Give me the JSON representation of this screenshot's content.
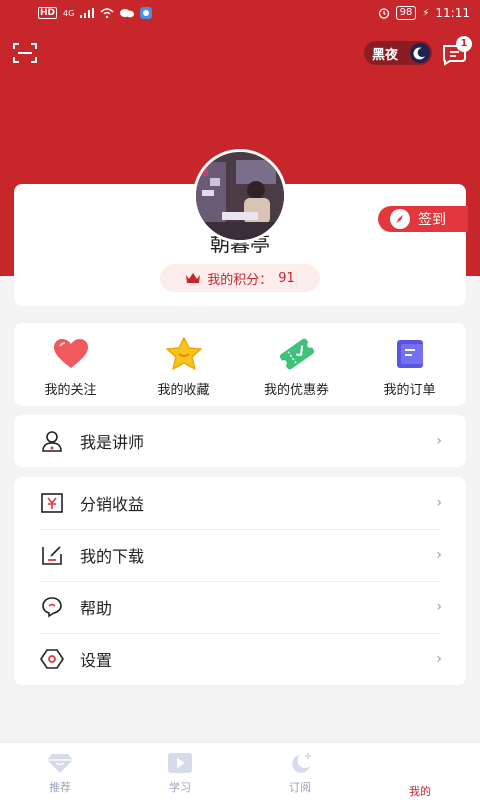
{
  "status_bar": {
    "network": "HD",
    "signal": "4G",
    "battery": "98",
    "time": "11:11"
  },
  "header": {
    "night_label": "黑夜",
    "message_count": "1"
  },
  "profile": {
    "name": "朝暮亭",
    "points_label": "我的积分：",
    "points_value": "91",
    "checkin_label": "签到"
  },
  "quick_actions": [
    {
      "label": "我的关注",
      "icon": "heart-icon"
    },
    {
      "label": "我的收藏",
      "icon": "star-icon"
    },
    {
      "label": "我的优惠券",
      "icon": "coupon-icon"
    },
    {
      "label": "我的订单",
      "icon": "order-icon"
    }
  ],
  "menu_teacher": [
    {
      "label": "我是讲师",
      "icon": "user-icon"
    }
  ],
  "menu_main": [
    {
      "label": "分销收益",
      "icon": "yuan-icon"
    },
    {
      "label": "我的下载",
      "icon": "download-icon"
    },
    {
      "label": "帮助",
      "icon": "help-icon"
    },
    {
      "label": "设置",
      "icon": "settings-icon"
    }
  ],
  "tabbar": [
    {
      "label": "推荐",
      "icon": "diamond-icon"
    },
    {
      "label": "学习",
      "icon": "play-icon"
    },
    {
      "label": "订阅",
      "icon": "moon-plus-icon"
    },
    {
      "label": "我的",
      "icon": "profile-icon"
    }
  ],
  "colors": {
    "brand": "#c7262b",
    "accent": "#e2383d"
  }
}
